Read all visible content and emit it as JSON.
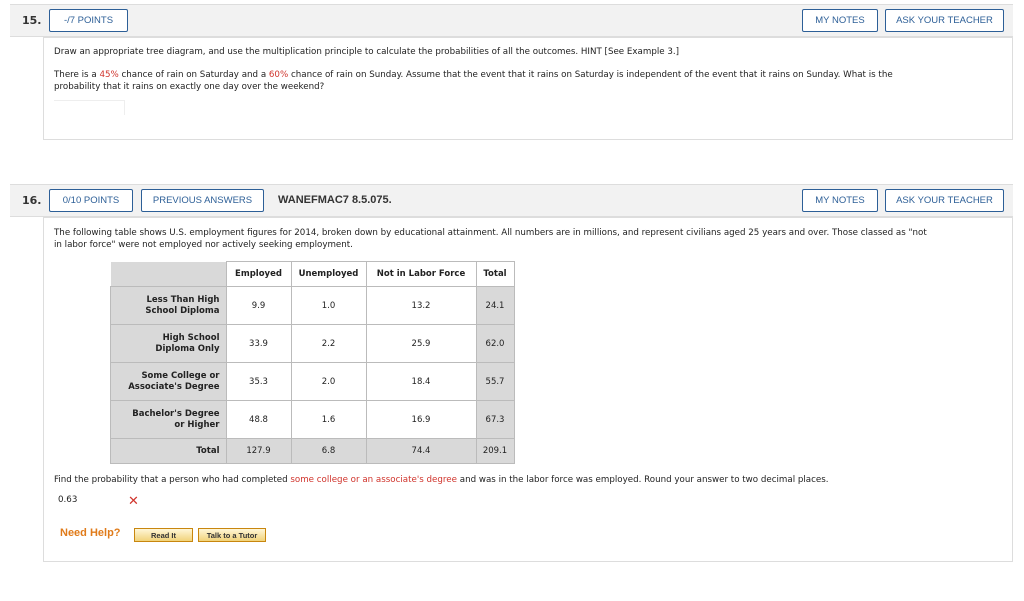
{
  "q15": {
    "number": "15.",
    "points": "-/7 POINTS",
    "my_notes": "MY NOTES",
    "ask_teacher": "ASK YOUR TEACHER",
    "instructions": "Draw an appropriate tree diagram, and use the multiplication principle to calculate the probabilities of all the outcomes. HINT [See Example 3.]",
    "p_a": "There is a ",
    "p_pct1": "45%",
    "p_b": " chance of rain on Saturday and a ",
    "p_pct2": "60%",
    "p_c": " chance of rain on Sunday. Assume that the event that it rains on Saturday is independent of the event that it rains on Sunday. What is the",
    "p_line2": "probability that it rains on exactly one day over the weekend?"
  },
  "q16": {
    "number": "16.",
    "points": "0/10 POINTS",
    "previous": "PREVIOUS ANSWERS",
    "code": "WANEFMAC7 8.5.075.",
    "my_notes": "MY NOTES",
    "ask_teacher": "ASK YOUR TEACHER",
    "intro_line1": "The following table shows U.S. employment figures for 2014, broken down by educational attainment. All numbers are in millions, and represent civilians aged 25 years and over. Those classed as \"not",
    "intro_line2": "in labor force\" were not employed nor actively seeking employment.",
    "table": {
      "headers": [
        "Employed",
        "Unemployed",
        "Not in Labor Force",
        "Total"
      ],
      "rows": [
        {
          "l1": "Less Than High",
          "l2": "School Diploma",
          "cells": [
            "9.9",
            "1.0",
            "13.2",
            "24.1"
          ]
        },
        {
          "l1": "High School",
          "l2": "Diploma Only",
          "cells": [
            "33.9",
            "2.2",
            "25.9",
            "62.0"
          ]
        },
        {
          "l1": "Some College or",
          "l2": "Associate's Degree",
          "cells": [
            "35.3",
            "2.0",
            "18.4",
            "55.7"
          ]
        },
        {
          "l1": "Bachelor's Degree",
          "l2": "or Higher",
          "cells": [
            "48.8",
            "1.6",
            "16.9",
            "67.3"
          ]
        }
      ],
      "total_row": {
        "label": "Total",
        "cells": [
          "127.9",
          "6.8",
          "74.4",
          "209.1"
        ]
      }
    },
    "question_a": "Find the probability that a person who had completed ",
    "question_hl": "some college or an associate's degree",
    "question_b": " and was in the labor force was employed. Round your answer to two decimal places.",
    "answer": "0.63",
    "result_mark": "✕",
    "need_help": "Need Help?",
    "read_it": "Read It",
    "talk_tutor": "Talk to a Tutor"
  }
}
